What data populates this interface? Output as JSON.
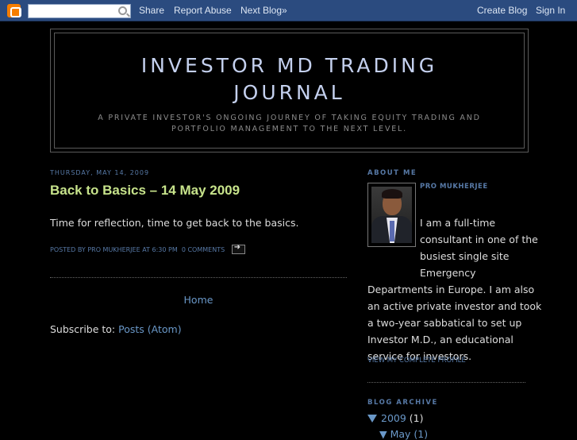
{
  "navbar": {
    "share": "Share",
    "report_abuse": "Report Abuse",
    "next_blog": "Next Blog»",
    "create_blog": "Create Blog",
    "sign_in": "Sign In",
    "search_placeholder": ""
  },
  "header": {
    "title": "INVESTOR MD TRADING JOURNAL",
    "description": "A PRIVATE INVESTOR'S ONGOING JOURNEY OF TAKING EQUITY TRADING AND PORTFOLIO MANAGEMENT TO THE NEXT LEVEL."
  },
  "post": {
    "date": "Thursday, May 14, 2009",
    "title": "Back to Basics – 14 May 2009",
    "body": "Time for reflection, time to get back to the basics.",
    "posted_by_prefix": "Posted by",
    "author": "Pro Mukherjee",
    "at": "at",
    "time": "6:30 PM",
    "comments": "0 comments"
  },
  "main": {
    "home_link": "Home",
    "subscribe_label": "Subscribe to:",
    "subscribe_link": "Posts (Atom)"
  },
  "sidebar": {
    "about_heading": "About Me",
    "profile_name": "Pro Mukherjee",
    "profile_lines": [
      "I am a full-time",
      "consultant in one of the",
      "busiest single site",
      "Emergency",
      "Departments in Europe. I am also",
      "an active private investor and took",
      "a two-year sabbatical to set up",
      "Investor M.D., an educational",
      "service for investors."
    ],
    "view_profile": "View my complete profile",
    "archive_heading": "Blog Archive",
    "archive_year": "2009",
    "archive_year_count": "(1)",
    "archive_month": "▼ May (1)"
  },
  "colors": {
    "navbar_bg": "#2b4b7f",
    "title_color": "#c4d0ee",
    "post_title_color": "#c7e38b",
    "link_color": "#6a98c8",
    "meta_color": "#5779a6"
  }
}
